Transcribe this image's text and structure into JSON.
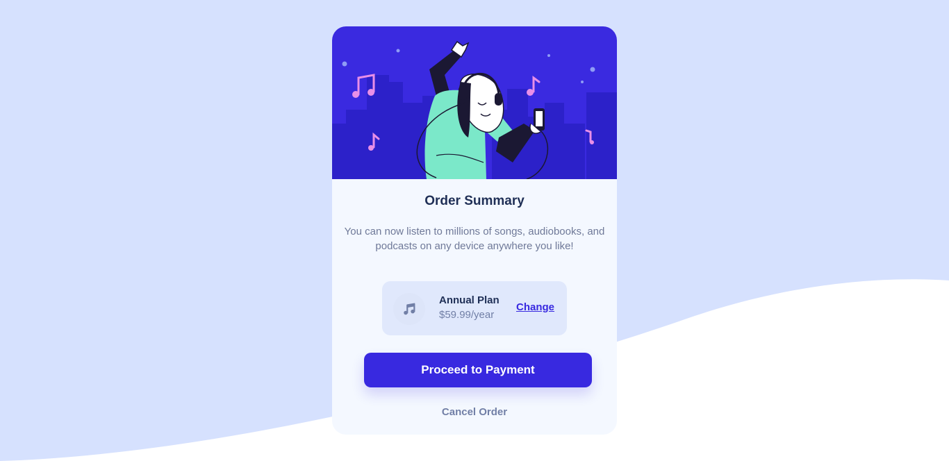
{
  "colors": {
    "page_background": "#d6e1fe",
    "wave": "#ffffff",
    "card_background": "#f4f8ff",
    "primary": "#3829e0",
    "heading": "#1f2f56",
    "muted": "#6f7998",
    "hero_background": "#3829e0"
  },
  "hero": {
    "image": "dancing-person-with-headphones-illustration"
  },
  "summary": {
    "title": "Order Summary",
    "description": "You can now listen to millions of songs, audiobooks, and podcasts on any device anywhere you like!"
  },
  "plan": {
    "icon": "music-note-icon",
    "name": "Annual Plan",
    "price": "$59.99/year",
    "change_label": "Change"
  },
  "actions": {
    "proceed_label": "Proceed to Payment",
    "cancel_label": "Cancel Order"
  }
}
